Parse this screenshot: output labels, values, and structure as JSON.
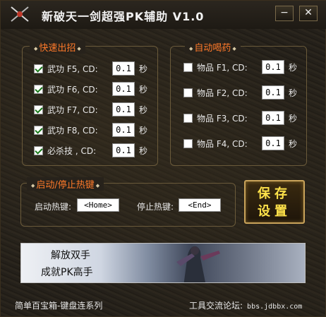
{
  "window": {
    "title": "新破天一剑超强PK辅助 V1.0",
    "minimize_glyph": "−",
    "close_glyph": "✕"
  },
  "skills": {
    "legend": "快速出招",
    "items": [
      {
        "label": "武功 F5, CD:",
        "value": "0.1",
        "unit": "秒",
        "checked": true
      },
      {
        "label": "武功 F6, CD:",
        "value": "0.1",
        "unit": "秒",
        "checked": true
      },
      {
        "label": "武功 F7, CD:",
        "value": "0.1",
        "unit": "秒",
        "checked": true
      },
      {
        "label": "武功 F8, CD:",
        "value": "0.1",
        "unit": "秒",
        "checked": true
      },
      {
        "label": "必杀技 , CD:",
        "value": "0.1",
        "unit": "秒",
        "checked": true
      }
    ]
  },
  "potions": {
    "legend": "自动喝药",
    "items": [
      {
        "label": "物品 F1, CD:",
        "value": "0.1",
        "unit": "秒",
        "checked": false
      },
      {
        "label": "物品 F2, CD:",
        "value": "0.1",
        "unit": "秒",
        "checked": false
      },
      {
        "label": "物品 F3, CD:",
        "value": "0.1",
        "unit": "秒",
        "checked": false
      },
      {
        "label": "物品 F4, CD:",
        "value": "0.1",
        "unit": "秒",
        "checked": false
      }
    ]
  },
  "hotkeys": {
    "legend": "启动/停止热键",
    "start_label": "启动热键:",
    "start_value": "<Home>",
    "stop_label": "停止热键:",
    "stop_value": "<End>"
  },
  "save_button": {
    "line1": "保存",
    "line2": "设置"
  },
  "banner": {
    "line1": "解放双手",
    "line2": "成就PK高手"
  },
  "footer": {
    "left": "简单百宝箱-键盘连系列",
    "right_label": "工具交流论坛:",
    "right_link": "bbs.jdbbx.com"
  },
  "colors": {
    "legend": "#ff7a2a",
    "save_text": "#ffe24a",
    "background": "#26211a"
  }
}
